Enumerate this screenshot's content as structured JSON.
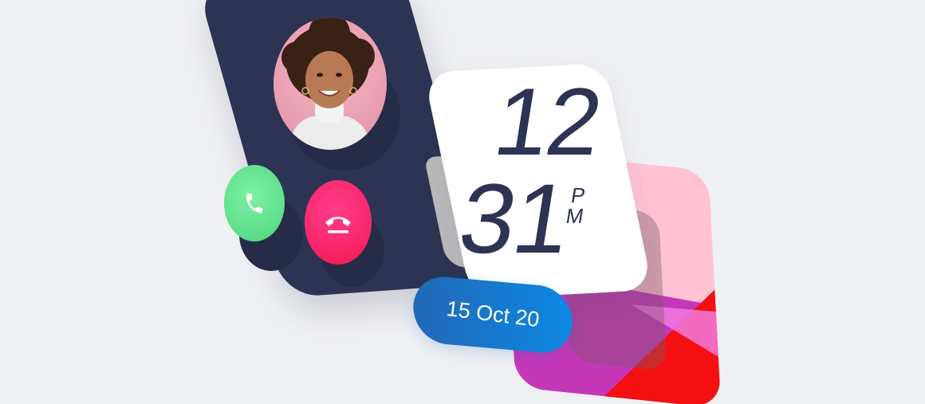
{
  "clock": {
    "hour": "12",
    "minute": "31",
    "ampm_p": "P",
    "ampm_m": "M"
  },
  "date": {
    "text": "15 Oct 20"
  },
  "call": {
    "accept_icon": "phone-icon",
    "decline_icon": "phone-hangup-icon"
  },
  "colors": {
    "background": "#eff0f3",
    "call_card": "#2d3453",
    "accept": "#58db86",
    "decline": "#f8266b",
    "date_pill": "#0d88e3",
    "clock_text": "#2d3453"
  }
}
